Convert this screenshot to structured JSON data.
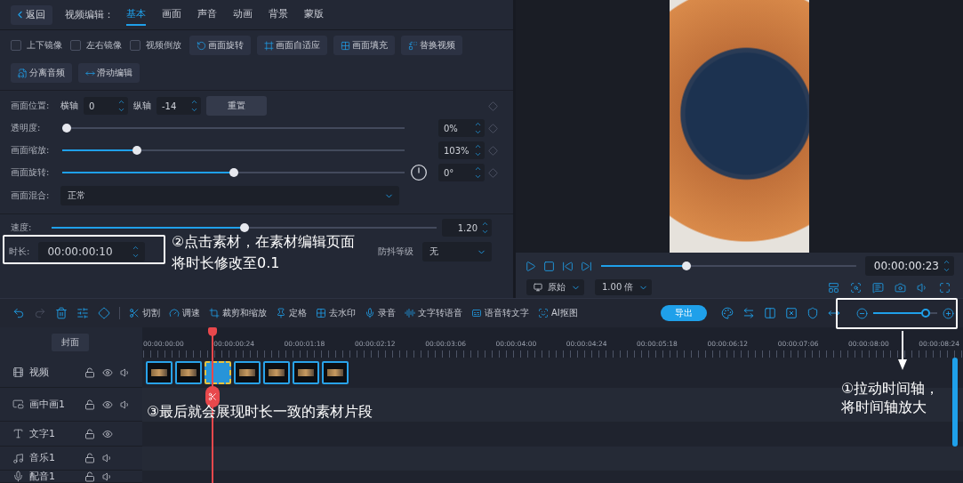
{
  "editor": {
    "back": "返回",
    "title": "视频编辑：",
    "tabs": [
      {
        "label": "基本",
        "selected": true
      },
      {
        "label": "画面",
        "selected": false
      },
      {
        "label": "声音",
        "selected": false
      },
      {
        "label": "动画",
        "selected": false
      },
      {
        "label": "背景",
        "selected": false
      },
      {
        "label": "蒙版",
        "selected": false
      }
    ]
  },
  "option_rows": [
    {
      "items": [
        {
          "kind": "checkbox",
          "label": "上下镜像",
          "checked": false
        },
        {
          "kind": "checkbox",
          "label": "左右镜像",
          "checked": false
        },
        {
          "kind": "checkbox",
          "label": "视频倒放",
          "checked": false
        },
        {
          "kind": "rotate",
          "label": "画面旋转"
        },
        {
          "kind": "fit",
          "label": "画面自适应"
        },
        {
          "kind": "fill",
          "label": "画面填充"
        },
        {
          "kind": "replace",
          "label": "替换视频"
        }
      ]
    },
    {
      "items": [
        {
          "kind": "split_audio",
          "label": "分离音频"
        },
        {
          "kind": "slide_edit",
          "label": "滑动编辑"
        }
      ]
    }
  ],
  "position": {
    "label": "画面位置:",
    "x_label": "横轴",
    "x_value": "0",
    "y_label": "纵轴",
    "y_value": "-14",
    "reset": "重置"
  },
  "sliders": [
    {
      "kind": "plain",
      "label": "透明度:",
      "level": 0.0,
      "value": "0%"
    },
    {
      "kind": "plain",
      "label": "画面缩放:",
      "level": 0.21,
      "value": "103%"
    },
    {
      "kind": "dial",
      "label": "画面旋转:",
      "level": 0.5,
      "value": "0°"
    }
  ],
  "blend": {
    "label": "画面混合:",
    "value": "正常"
  },
  "speed": {
    "label": "速度:",
    "level": 0.5,
    "value": "1.20"
  },
  "duration": {
    "label": "时长:",
    "value": "00:00:00:10"
  },
  "stabilize": {
    "label": "防抖等级",
    "value": "无"
  },
  "player": {
    "controls": [
      {
        "kind": "play"
      },
      {
        "kind": "stop"
      },
      {
        "kind": "prev"
      },
      {
        "kind": "next"
      }
    ],
    "level": 0.33,
    "time": "00:00:00:23",
    "ratio": "原始",
    "speed": "1.00 倍",
    "tools": [
      {
        "kind": "layout"
      },
      {
        "kind": "zoom"
      },
      {
        "kind": "subtitle"
      },
      {
        "kind": "camera"
      },
      {
        "kind": "volume"
      },
      {
        "kind": "fullscreen"
      }
    ]
  },
  "toolbar": {
    "actions": [
      {
        "kind": "undo",
        "disabled": false
      },
      {
        "kind": "redo",
        "disabled": true
      },
      {
        "kind": "delete",
        "disabled": false
      },
      {
        "kind": "adjust",
        "disabled": false
      },
      {
        "kind": "keyframe",
        "disabled": false
      }
    ],
    "tools": [
      {
        "kind": "cut",
        "label": "切割"
      },
      {
        "kind": "speed",
        "label": "调速"
      },
      {
        "kind": "crop",
        "label": "裁剪和缩放"
      },
      {
        "kind": "freeze",
        "label": "定格"
      },
      {
        "kind": "watermark",
        "label": "去水印"
      },
      {
        "kind": "record",
        "label": "录音"
      },
      {
        "kind": "tts",
        "label": "文字转语音"
      },
      {
        "kind": "stt",
        "label": "语音转文字"
      },
      {
        "kind": "matting",
        "label": "AI抠图"
      }
    ],
    "export": "导出",
    "extras": [
      {
        "kind": "palette"
      },
      {
        "kind": "swap"
      },
      {
        "kind": "columns"
      },
      {
        "kind": "crossbox"
      },
      {
        "kind": "shield"
      },
      {
        "kind": "stretch"
      }
    ],
    "zoom": {
      "level": 0.87
    }
  },
  "timeline": {
    "cover": "封面",
    "ticks": [
      "00:00:00:00",
      "00:00:00:24",
      "00:00:01:18",
      "00:00:02:12",
      "00:00:03:06",
      "00:00:04:00",
      "00:00:04:24",
      "00:00:05:18",
      "00:00:06:12",
      "00:00:07:06",
      "00:00:08:00",
      "00:00:08:24"
    ],
    "tracks": [
      {
        "kind": "video",
        "name": "视频",
        "clips": [
          {
            "selected": false
          },
          {
            "selected": false
          },
          {
            "selected": true
          },
          {
            "selected": false
          },
          {
            "selected": false
          },
          {
            "selected": false
          },
          {
            "selected": false
          }
        ]
      },
      {
        "kind": "pip",
        "name": "画中画1"
      },
      {
        "kind": "text",
        "name": "文字1"
      },
      {
        "kind": "music",
        "name": "音乐1"
      },
      {
        "kind": "voice",
        "name": "配音1"
      }
    ]
  },
  "notes": {
    "duration": [
      "②点击素材，在素材编辑页面",
      "将时长修改至0.1"
    ],
    "clips": "③最后就会展现时长一致的素材片段",
    "zoom": [
      "①拉动时间轴，",
      "将时间轴放大"
    ]
  }
}
